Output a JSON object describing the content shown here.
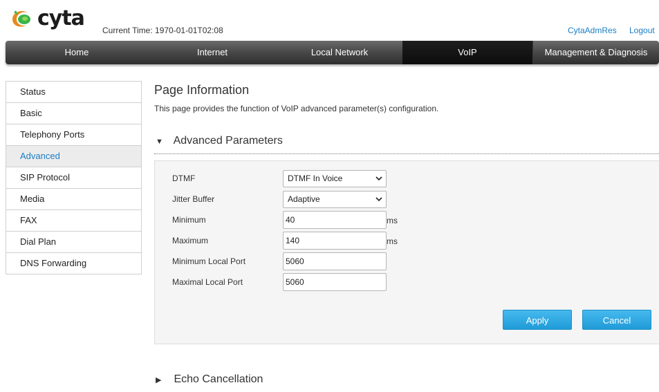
{
  "brand": {
    "name": "cyta",
    "accent": "#3bb54a",
    "swoosh_color": "#e68a1f"
  },
  "header": {
    "current_time_label": "Current Time:",
    "current_time_value": "1970-01-01T02:08",
    "user_link": "CytaAdmRes",
    "logout_link": "Logout"
  },
  "nav": {
    "items": [
      {
        "label": "Home"
      },
      {
        "label": "Internet"
      },
      {
        "label": "Local Network"
      },
      {
        "label": "VoIP",
        "active": true
      },
      {
        "label": "Management & Diagnosis"
      }
    ]
  },
  "sidebar": {
    "items": [
      {
        "label": "Status"
      },
      {
        "label": "Basic"
      },
      {
        "label": "Telephony Ports"
      },
      {
        "label": "Advanced",
        "active": true
      },
      {
        "label": "SIP Protocol"
      },
      {
        "label": "Media"
      },
      {
        "label": "FAX"
      },
      {
        "label": "Dial Plan"
      },
      {
        "label": "DNS Forwarding"
      }
    ]
  },
  "page": {
    "title": "Page Information",
    "description": "This page provides the function of VoIP advanced parameter(s) configuration."
  },
  "advanced": {
    "heading": "Advanced Parameters",
    "expanded_glyph": "▼",
    "fields": {
      "dtmf": {
        "label": "DTMF",
        "value": "DTMF In Voice"
      },
      "jitter_buffer": {
        "label": "Jitter Buffer",
        "value": "Adaptive"
      },
      "minimum": {
        "label": "Minimum",
        "value": "40",
        "unit": "ms"
      },
      "maximum": {
        "label": "Maximum",
        "value": "140",
        "unit": "ms"
      },
      "min_local_port": {
        "label": "Minimum Local Port",
        "value": "5060"
      },
      "max_local_port": {
        "label": "Maximal Local Port",
        "value": "5060"
      }
    },
    "apply_label": "Apply",
    "cancel_label": "Cancel"
  },
  "echo": {
    "heading": "Echo Cancellation",
    "collapsed_glyph": "▶"
  },
  "icons": {
    "dropdown": "chevron-down-icon",
    "expand": "triangle-down-icon",
    "collapse": "triangle-right-icon"
  }
}
